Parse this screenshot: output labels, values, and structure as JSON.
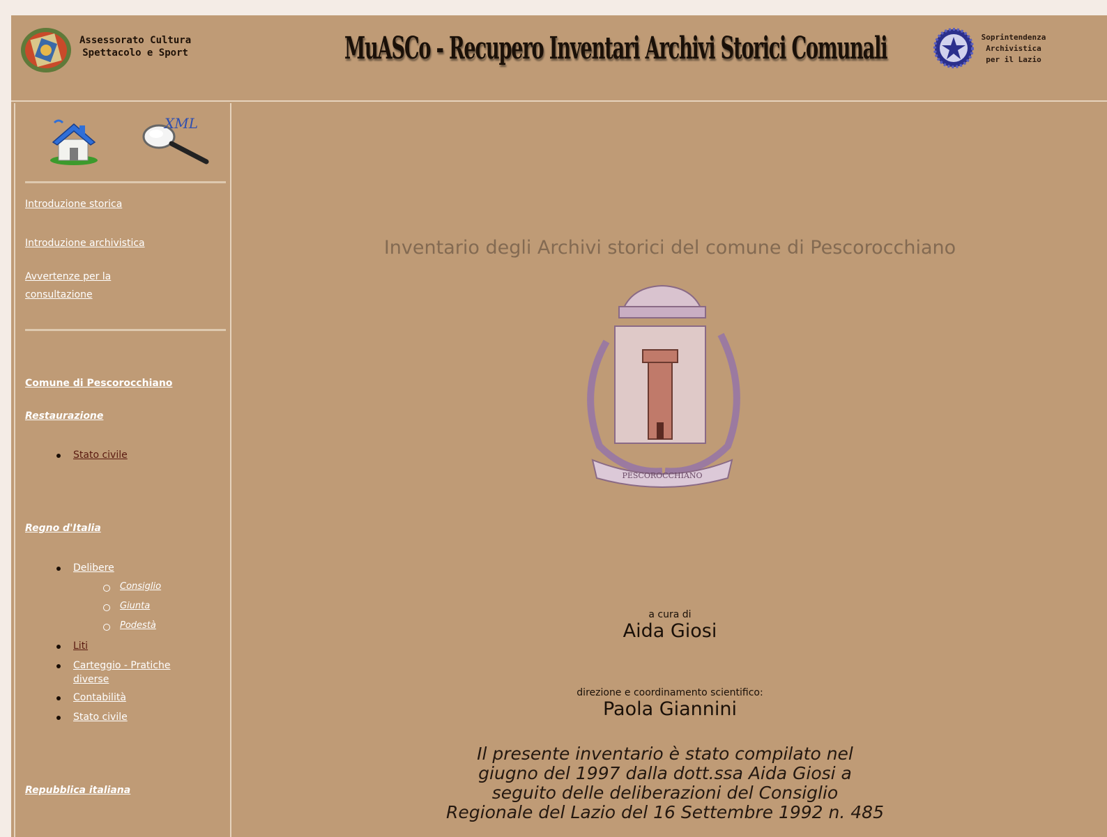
{
  "header": {
    "left_logo_icon": "regione-lazio-emblem-icon",
    "left_org": [
      "Assessorato Cultura",
      "Spettacolo e Sport"
    ],
    "banner": "MuASCo - Recupero Inventari Archivi Storici Comunali",
    "right_logo_icon": "italian-republic-emblem-icon",
    "right_org": [
      "Soprintendenza",
      "Archivistica",
      "per il Lazio"
    ]
  },
  "sidebar": {
    "home_icon": "home-icon",
    "xml_icon": "xml-magnifier-icon",
    "xml_label": "XML",
    "links": [
      "Introduzione storica",
      "Introduzione archivistica",
      "Avvertenze per la",
      "consultazione"
    ],
    "comune": "Comune di Pescorocchiano",
    "restaurazione": {
      "title": "Restaurazione",
      "items": [
        "Stato civile"
      ]
    },
    "regno": {
      "title": "Regno d'Italia",
      "delibere": "Delibere",
      "sub": [
        "Consiglio",
        "Giunta",
        "Podestà"
      ],
      "items": [
        "Liti",
        "Carteggio - Pratiche",
        "diverse",
        "Contabilità",
        "Stato civile"
      ]
    },
    "repubblica": "Repubblica italiana"
  },
  "main": {
    "title": "Inventario degli Archivi storici del comune di Pescorocchiano",
    "crest_icon": "pescorocchiano-coat-of-arms",
    "crest_label": "PESCOROCCHIANO",
    "curated_label": "a cura di",
    "curator": "Aida  Giosi",
    "direction_label": "direzione e coordinamento scientifico:",
    "director": "Paola  Giannini",
    "note_lines": [
      "Il presente inventario è stato compilato nel",
      "giugno del 1997 dalla dott.ssa Aida Giosi a",
      "seguito delle deliberazioni del Consiglio",
      "Regionale del Lazio del 16 Settembre 1992 n. 485"
    ]
  },
  "colors": {
    "page_bg": "#f4ece6",
    "frame_bg": "#bf9b76",
    "link_white": "#ffffff",
    "link_dark": "#5a1a10",
    "title_color": "#836a52"
  }
}
